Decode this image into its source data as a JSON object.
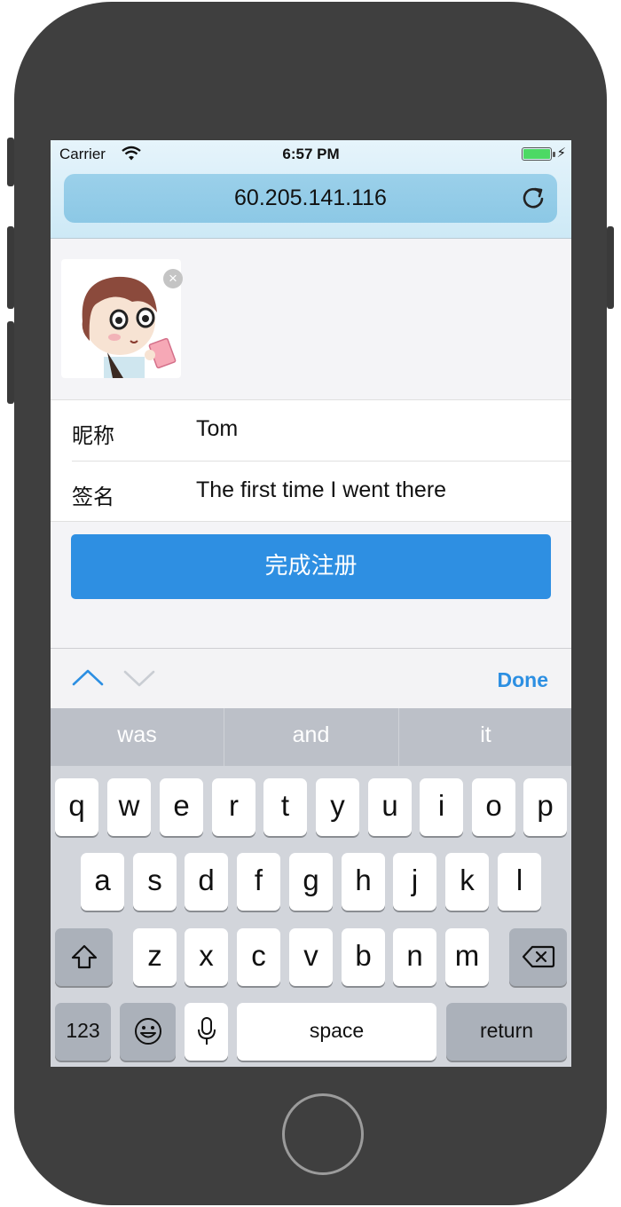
{
  "status_bar": {
    "carrier": "Carrier",
    "time": "6:57 PM"
  },
  "browser": {
    "url": "60.205.141.116"
  },
  "form": {
    "nickname_label": "昵称",
    "nickname_value": "Tom",
    "signature_label": "签名",
    "signature_value": "The first time I went there",
    "submit_label": "完成注册"
  },
  "accessory": {
    "done_label": "Done"
  },
  "keyboard": {
    "predictions": [
      "was",
      "and",
      "it"
    ],
    "row1": [
      "q",
      "w",
      "e",
      "r",
      "t",
      "y",
      "u",
      "i",
      "o",
      "p"
    ],
    "row2": [
      "a",
      "s",
      "d",
      "f",
      "g",
      "h",
      "j",
      "k",
      "l"
    ],
    "row3": [
      "z",
      "x",
      "c",
      "v",
      "b",
      "n",
      "m"
    ],
    "numbers_label": "123",
    "space_label": "space",
    "return_label": "return"
  },
  "icons": [
    "wifi-icon",
    "battery-icon",
    "charging-bolt-icon",
    "reload-icon",
    "remove-avatar-icon",
    "prev-field-icon",
    "next-field-icon",
    "shift-icon",
    "delete-icon",
    "emoji-icon",
    "microphone-icon"
  ],
  "colors": {
    "accent": "#2e8fe2",
    "battery": "#4cd964",
    "url_bar": "#8cc8e5"
  }
}
